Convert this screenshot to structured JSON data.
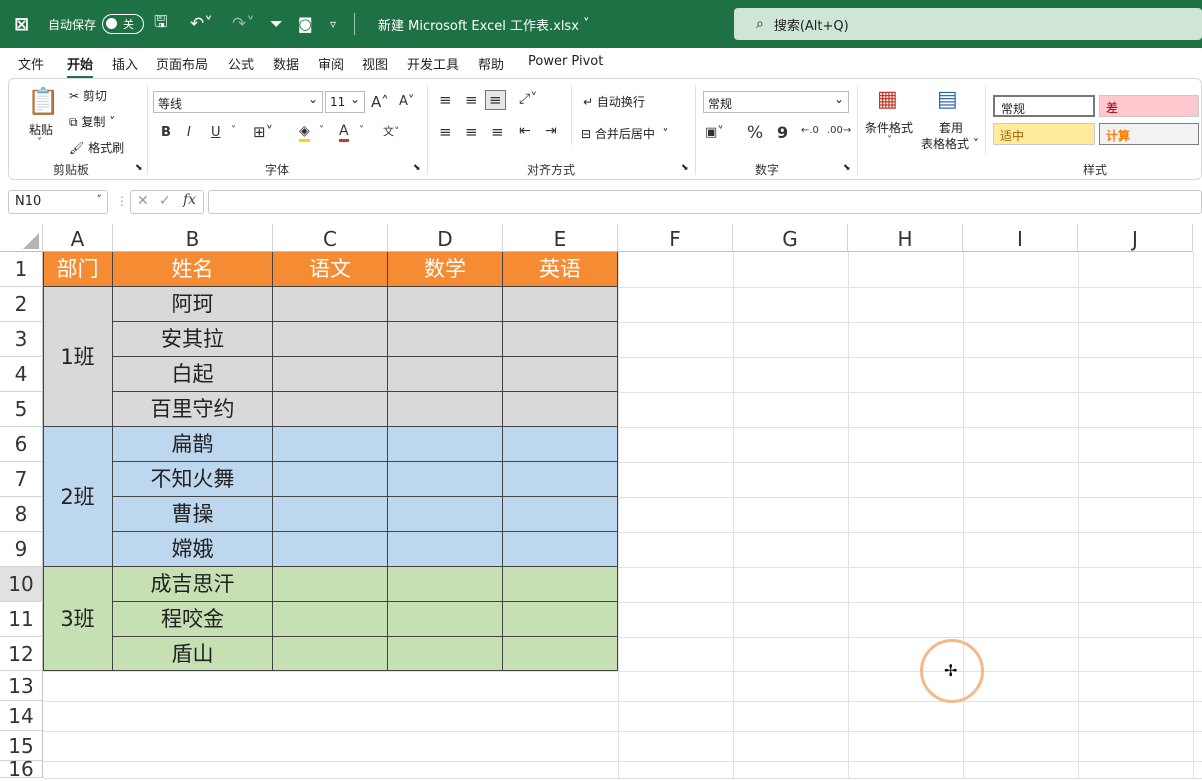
{
  "titlebar": {
    "autosave_label": "自动保存",
    "autosave_state": "关",
    "doc_title": "新建 Microsoft Excel 工作表.xlsx",
    "search_placeholder": "搜索(Alt+Q)"
  },
  "tabs": [
    "文件",
    "开始",
    "插入",
    "页面布局",
    "公式",
    "数据",
    "审阅",
    "视图",
    "开发工具",
    "帮助",
    "Power Pivot"
  ],
  "active_tab": "开始",
  "ribbon": {
    "clipboard": {
      "paste": "粘贴",
      "cut": "剪切",
      "copy": "复制",
      "format_painter": "格式刷",
      "group": "剪贴板"
    },
    "font": {
      "font_name": "等线",
      "font_size": "11",
      "bold": "B",
      "italic": "I",
      "underline": "U",
      "group": "字体"
    },
    "alignment": {
      "wrap_text": "自动换行",
      "merge_center": "合并后居中",
      "group": "对齐方式"
    },
    "number": {
      "format": "常规",
      "percent": "%",
      "comma": "9",
      "group": "数字"
    },
    "styles": {
      "conditional_format": "条件格式",
      "table_format_1": "套用",
      "table_format_2": "表格格式",
      "normal": "常规",
      "bad": "差",
      "neutral": "适中",
      "calculation": "计算",
      "group": "样式"
    }
  },
  "formula_bar": {
    "name_box": "N10",
    "fx": "fx",
    "formula": ""
  },
  "columns": [
    "A",
    "B",
    "C",
    "D",
    "E",
    "F",
    "G",
    "H",
    "I",
    "J"
  ],
  "rows": [
    "1",
    "2",
    "3",
    "4",
    "5",
    "6",
    "7",
    "8",
    "9",
    "10",
    "11",
    "12",
    "13",
    "14",
    "15",
    "16"
  ],
  "table": {
    "headers": [
      "部门",
      "姓名",
      "语文",
      "数学",
      "英语"
    ],
    "groups": [
      {
        "dept": "1班",
        "names": [
          "阿珂",
          "安其拉",
          "白起",
          "百里守约"
        ]
      },
      {
        "dept": "2班",
        "names": [
          "扁鹊",
          "不知火舞",
          "曹操",
          "嫦娥"
        ]
      },
      {
        "dept": "3班",
        "names": [
          "成吉思汗",
          "程咬金",
          "盾山"
        ]
      }
    ]
  },
  "colors": {
    "header": "#f58b33",
    "group1": "#d9d9d9",
    "group2": "#bdd7ee",
    "group3": "#c6e0b4",
    "titlebar": "#1e7145"
  }
}
